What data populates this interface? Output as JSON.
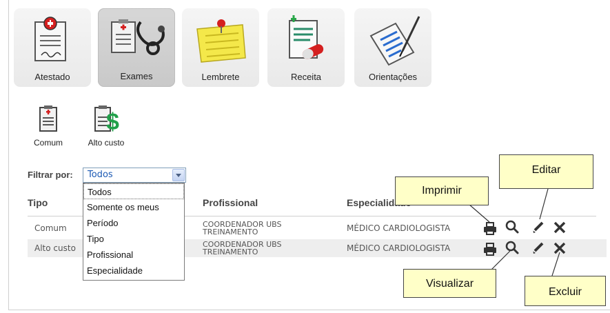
{
  "tiles": [
    {
      "label": "Atestado",
      "icon": "certificate-icon"
    },
    {
      "label": "Exames",
      "icon": "stethoscope-clipboard-icon"
    },
    {
      "label": "Lembrete",
      "icon": "sticky-note-icon"
    },
    {
      "label": "Receita",
      "icon": "prescription-pills-icon"
    },
    {
      "label": "Orientações",
      "icon": "document-pen-icon"
    }
  ],
  "sub_buttons": [
    {
      "label": "Comum",
      "icon": "clipboard-icon"
    },
    {
      "label": "Alto custo",
      "icon": "clipboard-dollar-icon"
    }
  ],
  "filter": {
    "label": "Filtrar por:",
    "selected": "Todos",
    "options": [
      "Todos",
      "Somente os meus",
      "Período",
      "Tipo",
      "Profissional",
      "Especialidade"
    ]
  },
  "table": {
    "columns": {
      "tipo": "Tipo",
      "profissional": "Profissional",
      "especialidade": "Especialidade"
    },
    "rows": [
      {
        "tipo": "Comum",
        "profissional_1": "COORDENADOR UBS",
        "profissional_2": "TREINAMENTO",
        "especialidade": "MÉDICO CARDIOLOGISTA"
      },
      {
        "tipo": "Alto custo",
        "profissional_1": "COORDENADOR UBS",
        "profissional_2": "TREINAMENTO",
        "especialidade": "MÉDICO CARDIOLOGISTA"
      }
    ]
  },
  "callouts": {
    "imprimir": "Imprimir",
    "editar": "Editar",
    "visualizar": "Visualizar",
    "excluir": "Excluir"
  },
  "colors": {
    "callout_bg": "#ffffc8",
    "accent_blue": "#1a58b3",
    "icon_dark": "#333333"
  }
}
